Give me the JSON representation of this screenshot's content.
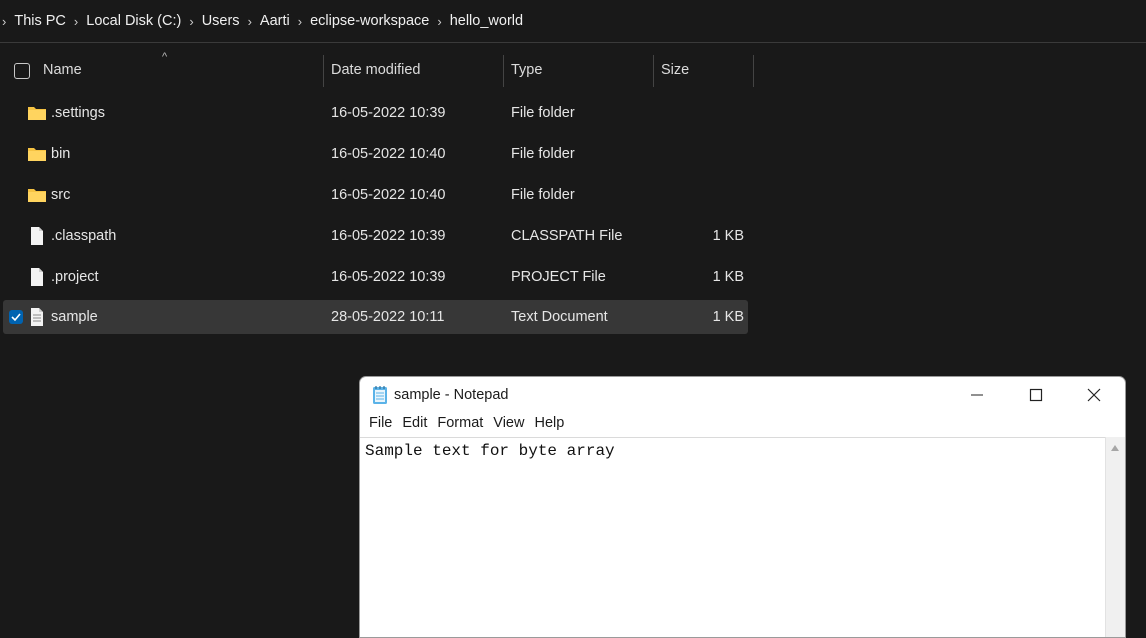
{
  "breadcrumb": [
    "This PC",
    "Local Disk (C:)",
    "Users",
    "Aarti",
    "eclipse-workspace",
    "hello_world"
  ],
  "columns": {
    "name": "Name",
    "date": "Date modified",
    "type": "Type",
    "size": "Size"
  },
  "files": [
    {
      "name": ".settings",
      "date": "16-05-2022 10:39",
      "type": "File folder",
      "size": "",
      "kind": "folder-icon"
    },
    {
      "name": "bin",
      "date": "16-05-2022 10:40",
      "type": "File folder",
      "size": "",
      "kind": "folder-icon"
    },
    {
      "name": "src",
      "date": "16-05-2022 10:40",
      "type": "File folder",
      "size": "",
      "kind": "folder-icon"
    },
    {
      "name": ".classpath",
      "date": "16-05-2022 10:39",
      "type": "CLASSPATH File",
      "size": "1 KB",
      "kind": "file-icon"
    },
    {
      "name": ".project",
      "date": "16-05-2022 10:39",
      "type": "PROJECT File",
      "size": "1 KB",
      "kind": "file-icon"
    },
    {
      "name": "sample",
      "date": "28-05-2022 10:11",
      "type": "Text Document",
      "size": "1 KB",
      "kind": "text-file-icon",
      "selected": true
    }
  ],
  "notepad": {
    "title": "sample - Notepad",
    "menu": [
      "File",
      "Edit",
      "Format",
      "View",
      "Help"
    ],
    "content": "Sample text for byte array"
  },
  "colors": {
    "accent": "#0063b1",
    "folder": "#f6c343",
    "background": "#191919"
  }
}
